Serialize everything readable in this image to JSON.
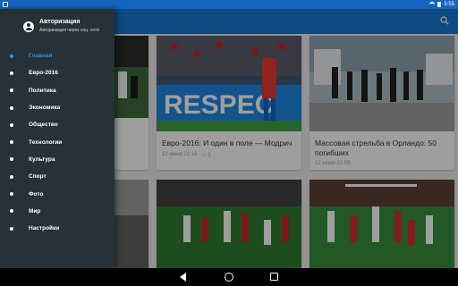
{
  "status_bar": {
    "time": "5:55"
  },
  "drawer": {
    "auth_title": "Авторизация",
    "auth_subtitle": "Авторизация через соц. сети",
    "items": [
      {
        "label": "Главная",
        "active": true
      },
      {
        "label": "Евро-2016"
      },
      {
        "label": "Политика"
      },
      {
        "label": "Экономика"
      },
      {
        "label": "Общество"
      },
      {
        "label": "Технологии"
      },
      {
        "label": "Культура"
      },
      {
        "label": "Спорт"
      },
      {
        "label": "Фото"
      },
      {
        "label": "Мир"
      },
      {
        "label": "Настройки"
      }
    ]
  },
  "cards": [
    {
      "title": "Евро-2016: И один в поле — Модрич",
      "date": "12 июня 21:16",
      "comments": "1",
      "image_text": "RESPEC"
    },
    {
      "title": "Массовая стрельба в Орландо: 50 погибших",
      "date": "12 июня 21:09"
    }
  ],
  "colors": {
    "primary": "#1976d2",
    "status": "#1565c0",
    "drawer_bg": "#263238",
    "accent": "#2196f3"
  }
}
